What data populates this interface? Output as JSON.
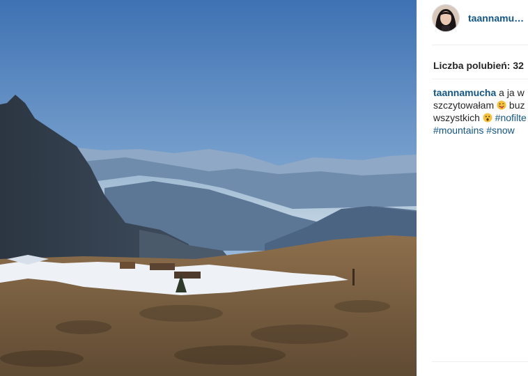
{
  "post": {
    "username": "taannamu…",
    "likes_label": "Liczba polubień: 32",
    "caption": {
      "user": "taannamucha",
      "line1_text": " a ja w",
      "line2_text": "szczytowałam ",
      "line2_after": " buz",
      "line3_text": "wszystkich ",
      "line3_hashtag": " #nofilte",
      "line4_hashtags": [
        "#mountains",
        "#snow"
      ]
    }
  },
  "photo": {
    "description_icon": "mountain-landscape-photo"
  }
}
